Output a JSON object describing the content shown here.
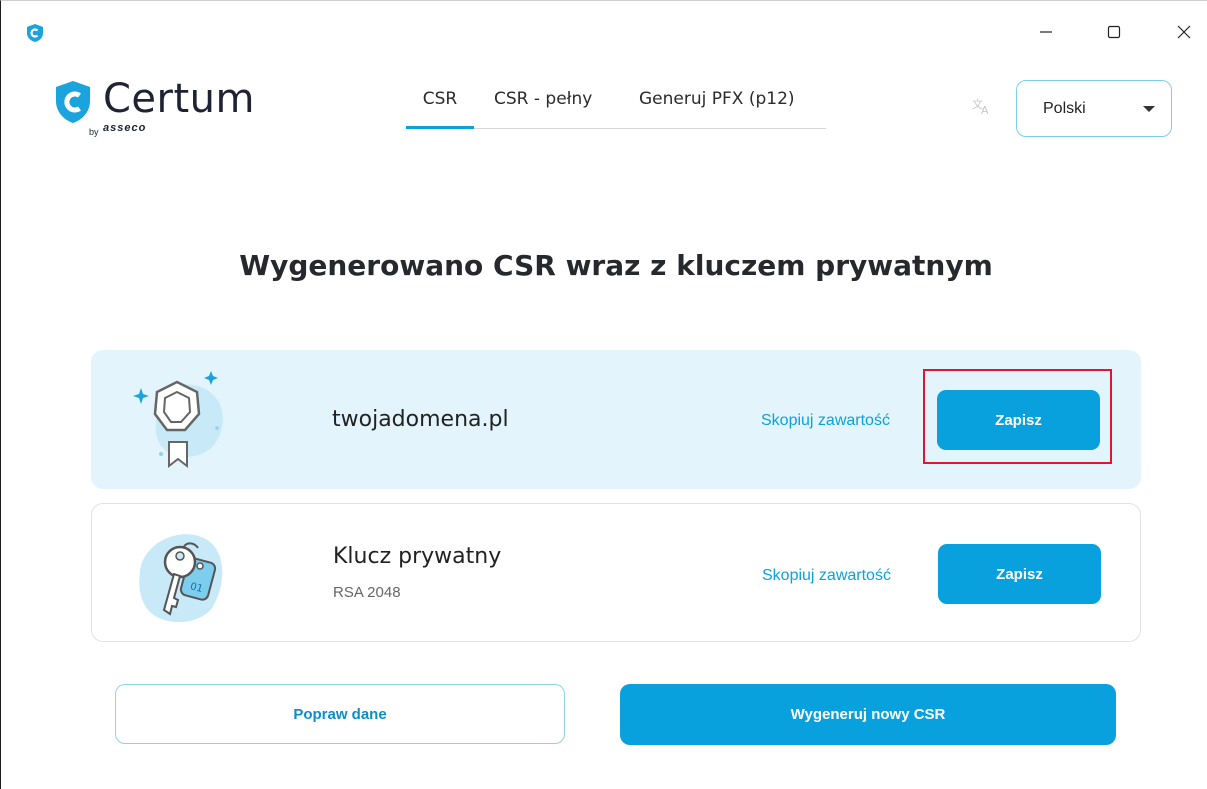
{
  "window": {
    "app_icon": "certum-shield-icon",
    "controls": {
      "minimize": "—",
      "maximize": "☐",
      "close": "✕"
    }
  },
  "header": {
    "logo_text": "Certum",
    "logo_by": "by",
    "logo_asseco": "asseco",
    "tabs": [
      {
        "label": "CSR",
        "active": true
      },
      {
        "label": "CSR - pełny",
        "active": false
      },
      {
        "label": "Generuj PFX (p12)",
        "active": false
      }
    ],
    "translate_icon": "translate-icon",
    "language": {
      "selected": "Polski"
    }
  },
  "main": {
    "heading": "Wygenerowano CSR wraz z kluczem prywatnym",
    "cards": [
      {
        "title": "twojadomena.pl",
        "subtitle": "",
        "copy_label": "Skopiuj zawartość",
        "save_label": "Zapisz",
        "icon": "certificate-badge-icon"
      },
      {
        "title": "Klucz prywatny",
        "subtitle": "RSA 2048",
        "copy_label": "Skopiuj zawartość",
        "save_label": "Zapisz",
        "icon": "keys-icon"
      }
    ]
  },
  "footer": {
    "fix_label": "Popraw dane",
    "new_label": "Wygeneruj nowy CSR"
  },
  "colors": {
    "accent": "#08a1dd",
    "card_highlight_bg": "#e3f4fc",
    "highlight_border": "#e0162b",
    "text": "#26282d"
  }
}
